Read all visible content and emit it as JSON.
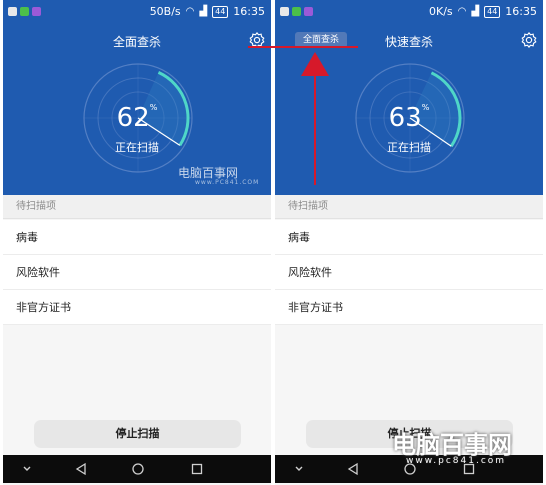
{
  "colors": {
    "header_bg": "#1f5bb0",
    "arc_accent": "#4fd6c8",
    "list_bg": "#ffffff",
    "section_bg": "#f0f0f0",
    "nav_bg": "#0c0c0c",
    "annotation_red": "#d6192a"
  },
  "left": {
    "status": {
      "speed": "50B/s",
      "battery": "44",
      "time": "16:35"
    },
    "title": "全面查杀",
    "progress": {
      "value": "62",
      "unit": "%",
      "fraction": 0.62
    },
    "scan_status": "正在扫描",
    "watermark": {
      "name": "电脑百事网",
      "url": "www.PC841.COM"
    },
    "section_header": "待扫描项",
    "items": [
      "病毒",
      "风险软件",
      "非官方证书"
    ],
    "stop_button": "停止扫描"
  },
  "right": {
    "status": {
      "speed": "0K/s",
      "battery": "44",
      "time": "16:35"
    },
    "tab_chip": "全面查杀",
    "title": "快速查杀",
    "progress": {
      "value": "63",
      "unit": "%",
      "fraction": 0.63
    },
    "scan_status": "正在扫描",
    "section_header": "待扫描项",
    "items": [
      "病毒",
      "风险软件",
      "非官方证书"
    ],
    "stop_button": "停止扫描",
    "watermark": {
      "name": "电脑百事网",
      "url": "www.pc841.com"
    }
  },
  "icons": {
    "settings": "gear-icon",
    "nav": [
      "chevron-down-icon",
      "back-icon",
      "home-icon",
      "recents-icon"
    ],
    "status_left": [
      "notification-icon",
      "wechat-icon",
      "app-icon"
    ]
  }
}
